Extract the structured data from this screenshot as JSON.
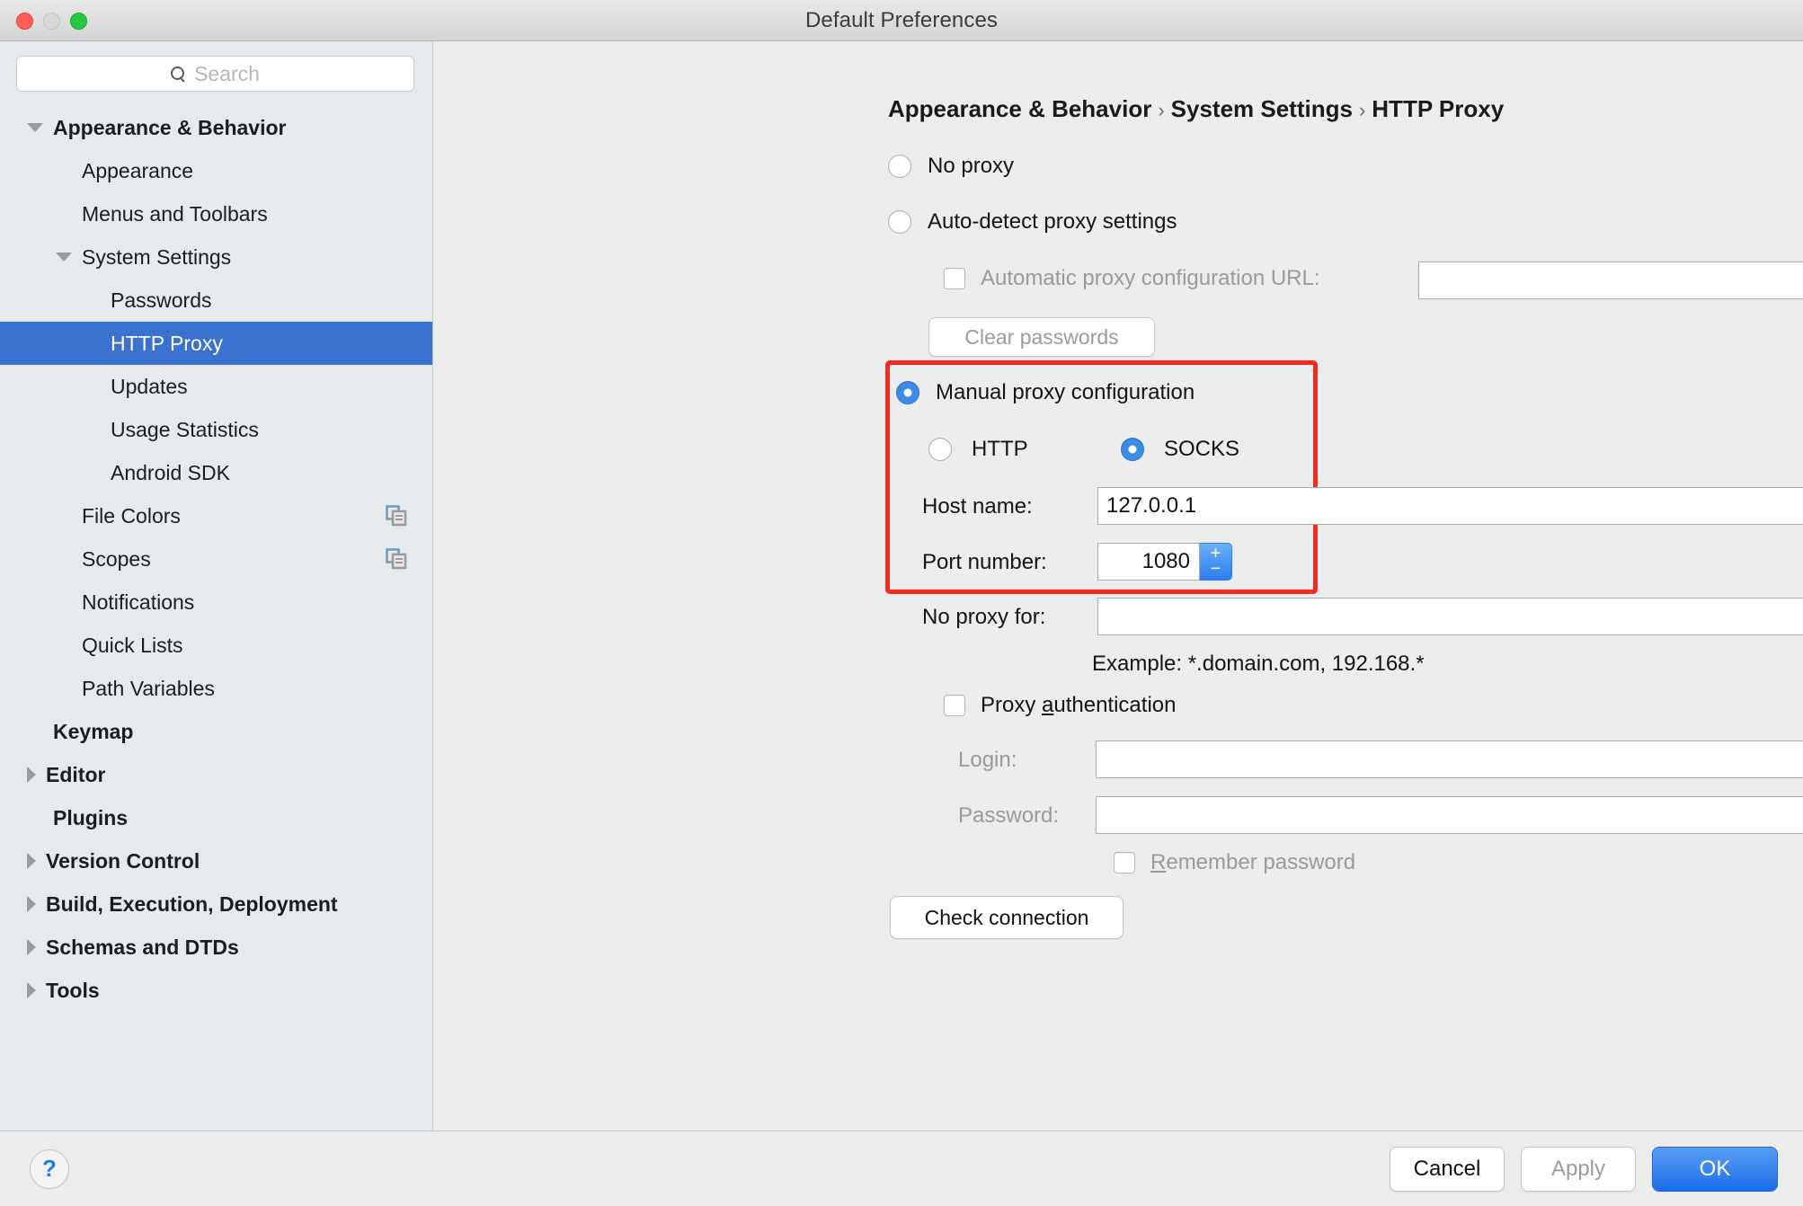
{
  "window": {
    "title": "Default Preferences",
    "traffic_lights": [
      "close",
      "minimize",
      "maximize"
    ]
  },
  "search": {
    "placeholder": "Search",
    "icon": "search-icon"
  },
  "sidebar": {
    "items": [
      {
        "label": "Appearance & Behavior",
        "indent": 0,
        "arrow": "down",
        "bold": true,
        "selected": false,
        "copy_icon": false
      },
      {
        "label": "Appearance",
        "indent": 1,
        "arrow": "none",
        "bold": false,
        "selected": false,
        "copy_icon": false
      },
      {
        "label": "Menus and Toolbars",
        "indent": 1,
        "arrow": "none",
        "bold": false,
        "selected": false,
        "copy_icon": false
      },
      {
        "label": "System Settings",
        "indent": 1,
        "arrow": "down",
        "bold": false,
        "selected": false,
        "copy_icon": false
      },
      {
        "label": "Passwords",
        "indent": 2,
        "arrow": "none",
        "bold": false,
        "selected": false,
        "copy_icon": false
      },
      {
        "label": "HTTP Proxy",
        "indent": 2,
        "arrow": "none",
        "bold": false,
        "selected": true,
        "copy_icon": false
      },
      {
        "label": "Updates",
        "indent": 2,
        "arrow": "none",
        "bold": false,
        "selected": false,
        "copy_icon": false
      },
      {
        "label": "Usage Statistics",
        "indent": 2,
        "arrow": "none",
        "bold": false,
        "selected": false,
        "copy_icon": false
      },
      {
        "label": "Android SDK",
        "indent": 2,
        "arrow": "none",
        "bold": false,
        "selected": false,
        "copy_icon": false
      },
      {
        "label": "File Colors",
        "indent": 1,
        "arrow": "none",
        "bold": false,
        "selected": false,
        "copy_icon": true
      },
      {
        "label": "Scopes",
        "indent": 1,
        "arrow": "none",
        "bold": false,
        "selected": false,
        "copy_icon": true
      },
      {
        "label": "Notifications",
        "indent": 1,
        "arrow": "none",
        "bold": false,
        "selected": false,
        "copy_icon": false
      },
      {
        "label": "Quick Lists",
        "indent": 1,
        "arrow": "none",
        "bold": false,
        "selected": false,
        "copy_icon": false
      },
      {
        "label": "Path Variables",
        "indent": 1,
        "arrow": "none",
        "bold": false,
        "selected": false,
        "copy_icon": false
      },
      {
        "label": "Keymap",
        "indent": 0,
        "arrow": "none",
        "bold": true,
        "selected": false,
        "copy_icon": false
      },
      {
        "label": "Editor",
        "indent": 0,
        "arrow": "right",
        "bold": true,
        "selected": false,
        "copy_icon": false
      },
      {
        "label": "Plugins",
        "indent": 0,
        "arrow": "none",
        "bold": true,
        "selected": false,
        "copy_icon": false
      },
      {
        "label": "Version Control",
        "indent": 0,
        "arrow": "right",
        "bold": true,
        "selected": false,
        "copy_icon": false
      },
      {
        "label": "Build, Execution, Deployment",
        "indent": 0,
        "arrow": "right",
        "bold": true,
        "selected": false,
        "copy_icon": false
      },
      {
        "label": "Schemas and DTDs",
        "indent": 0,
        "arrow": "right",
        "bold": true,
        "selected": false,
        "copy_icon": false
      },
      {
        "label": "Tools",
        "indent": 0,
        "arrow": "right",
        "bold": true,
        "selected": false,
        "copy_icon": false
      }
    ]
  },
  "breadcrumb": {
    "part1": "Appearance & Behavior",
    "sep1": "›",
    "part2": "System Settings",
    "sep2": "›",
    "part3": "HTTP Proxy"
  },
  "proxy": {
    "no_proxy_label": "No proxy",
    "no_proxy_selected": false,
    "auto_detect_label": "Auto-detect proxy settings",
    "auto_detect_selected": false,
    "auto_url_label": "Automatic proxy configuration URL:",
    "auto_url_checked": false,
    "auto_url_value": "",
    "clear_passwords_label": "Clear passwords",
    "clear_passwords_enabled": false,
    "manual_label": "Manual proxy configuration",
    "manual_selected": true,
    "http_label": "HTTP",
    "http_selected": false,
    "socks_label": "SOCKS",
    "socks_selected": true,
    "host_label": "Host name:",
    "host_value": "127.0.0.1",
    "port_label": "Port number:",
    "port_value": "1080",
    "spinner_up": "+",
    "spinner_down": "−",
    "no_proxy_for_label": "No proxy for:",
    "no_proxy_for_value": "",
    "browse_label": "...",
    "example_text": "Example: *.domain.com, 192.168.*",
    "auth_label_pre": "Proxy ",
    "auth_label_mnemonic": "a",
    "auth_label_post": "uthentication",
    "auth_checked": false,
    "login_label": "Login:",
    "login_value": "",
    "password_label": "Password:",
    "password_value": "",
    "remember_mnemonic": "R",
    "remember_label_post": "emember password",
    "remember_checked": false,
    "check_connection_label": "Check connection"
  },
  "highlight": {
    "color": "#f42b1c"
  },
  "footer": {
    "help_label": "?",
    "cancel_label": "Cancel",
    "apply_label": "Apply",
    "apply_enabled": false,
    "ok_label": "OK"
  },
  "colors": {
    "selection_blue": "#3b72cf",
    "accent_blue": "#1f7af0",
    "highlight_red": "#f42b1c",
    "sidebar_bg": "#e6eaed",
    "main_bg": "#ececec"
  }
}
